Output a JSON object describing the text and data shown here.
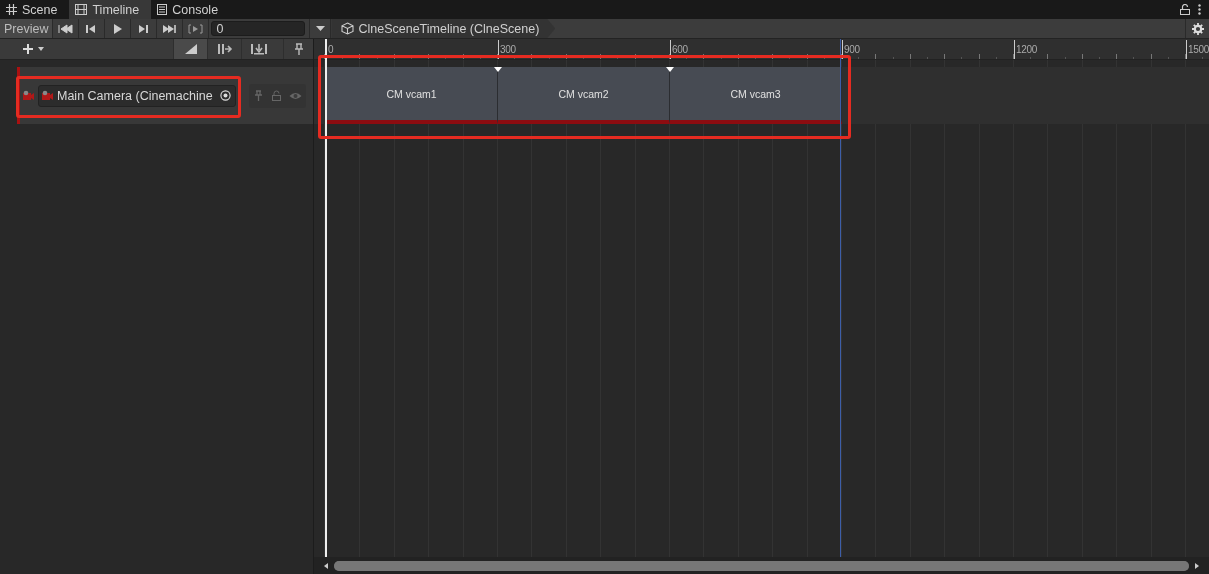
{
  "tabs": [
    {
      "label": "Scene",
      "selected": false
    },
    {
      "label": "Timeline",
      "selected": true
    },
    {
      "label": "Console",
      "selected": false
    }
  ],
  "toolbar": {
    "preview": {
      "label": "Preview",
      "on": false
    },
    "frame_field": {
      "value": "0"
    },
    "breadcrumb": "ClneSceneTimeline (ClneScene)"
  },
  "ruler": {
    "labels": [
      "0",
      "300",
      "600",
      "900",
      "1200",
      "1500"
    ]
  },
  "tracks": [
    {
      "binding": "Main Camera (Cinemachine",
      "clips": [
        {
          "label": "CM vcam1"
        },
        {
          "label": "CM vcam2"
        },
        {
          "label": "CM vcam3"
        }
      ]
    }
  ]
}
